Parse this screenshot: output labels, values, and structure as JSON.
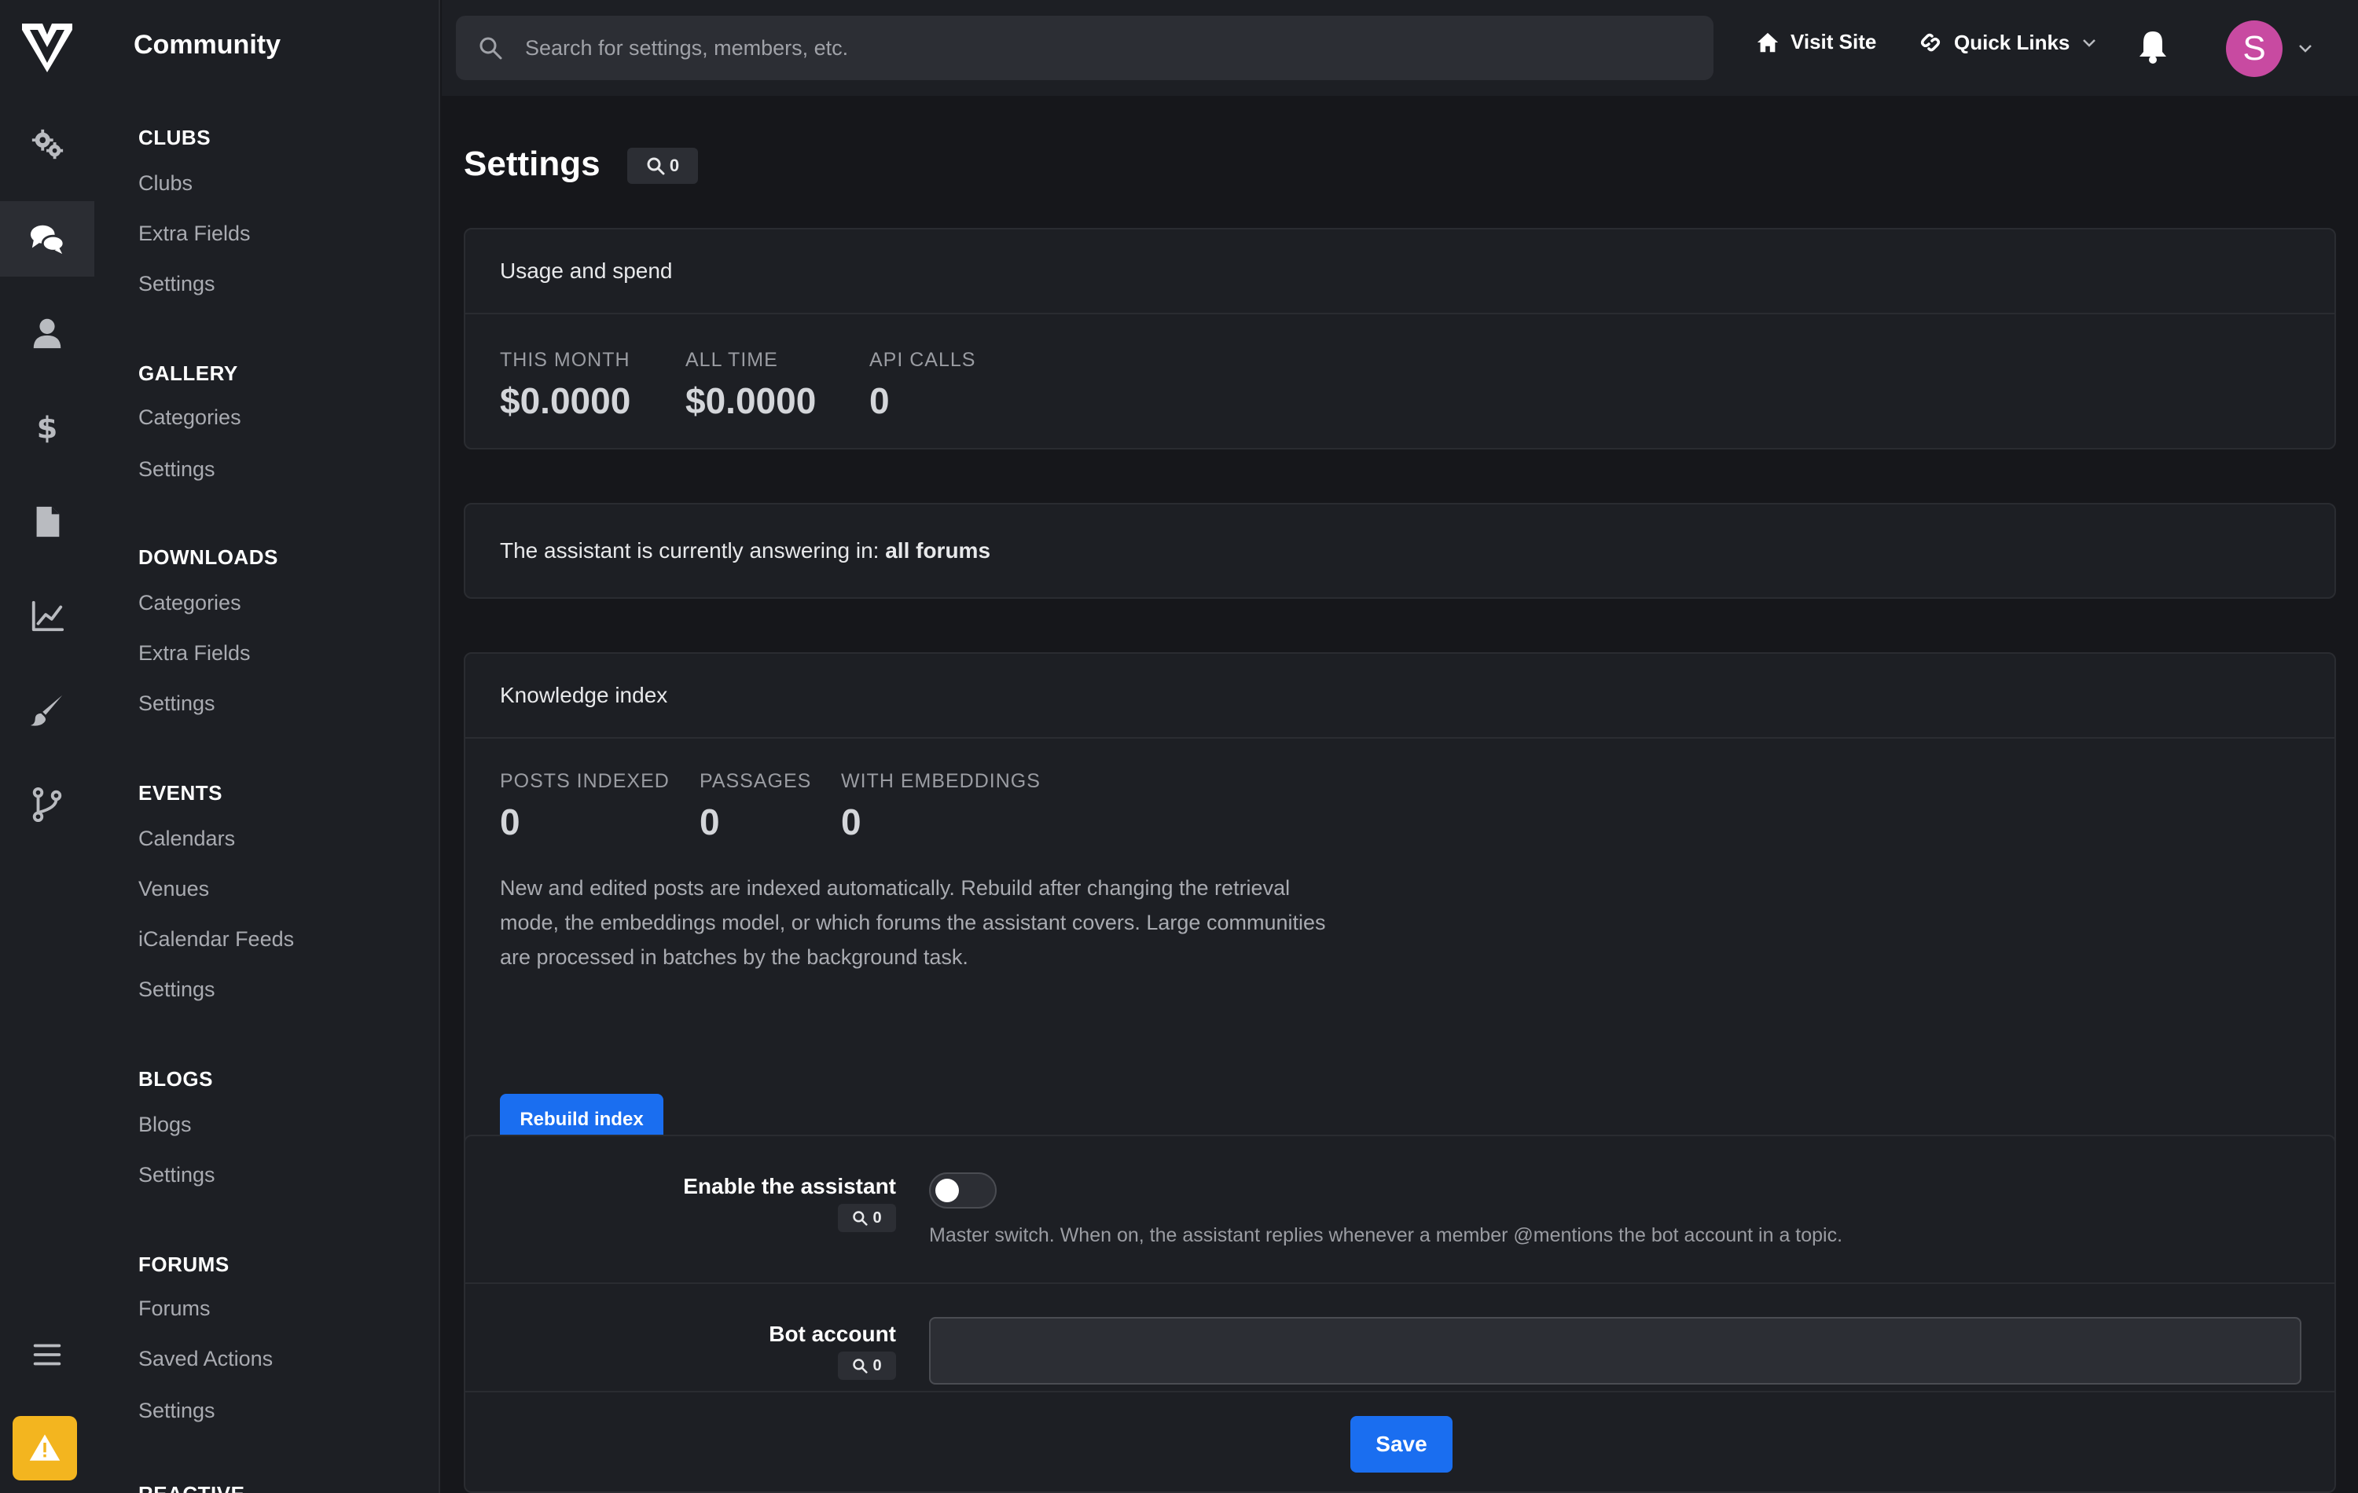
{
  "app": {
    "brand": "Community"
  },
  "rail": {
    "items": [
      {
        "icon": "gears-icon",
        "active": false
      },
      {
        "icon": "chat-bubbles-icon",
        "active": true
      },
      {
        "icon": "user-icon",
        "active": false
      },
      {
        "icon": "dollar-icon",
        "active": false
      },
      {
        "icon": "file-icon",
        "active": false
      },
      {
        "icon": "chart-line-icon",
        "active": false
      },
      {
        "icon": "brush-icon",
        "active": false
      },
      {
        "icon": "code-branch-icon",
        "active": false
      }
    ]
  },
  "sidebar": {
    "groups": [
      {
        "heading": "CLUBS",
        "items": [
          "Clubs",
          "Extra Fields",
          "Settings"
        ]
      },
      {
        "heading": "GALLERY",
        "items": [
          "Categories",
          "Settings"
        ]
      },
      {
        "heading": "DOWNLOADS",
        "items": [
          "Categories",
          "Extra Fields",
          "Settings"
        ]
      },
      {
        "heading": "EVENTS",
        "items": [
          "Calendars",
          "Venues",
          "iCalendar Feeds",
          "Settings"
        ]
      },
      {
        "heading": "BLOGS",
        "items": [
          "Blogs",
          "Settings"
        ]
      },
      {
        "heading": "FORUMS",
        "items": [
          "Forums",
          "Saved Actions",
          "Settings"
        ]
      },
      {
        "heading": "REACTIVE",
        "items": []
      }
    ]
  },
  "topbar": {
    "search_placeholder": "Search for settings, members, etc.",
    "visit_site": "Visit Site",
    "quick_links": "Quick Links",
    "avatar_letter": "S"
  },
  "page": {
    "title": "Settings",
    "search_hits": "0"
  },
  "usage": {
    "heading": "Usage and spend",
    "stats": [
      {
        "label": "THIS MONTH",
        "value": "$0.0000"
      },
      {
        "label": "ALL TIME",
        "value": "$0.0000"
      },
      {
        "label": "API CALLS",
        "value": "0"
      }
    ]
  },
  "scope": {
    "prefix": "The assistant is currently answering in:",
    "value": "all forums"
  },
  "knowledge": {
    "heading": "Knowledge index",
    "stats": [
      {
        "label": "POSTS INDEXED",
        "value": "0"
      },
      {
        "label": "PASSAGES",
        "value": "0"
      },
      {
        "label": "WITH EMBEDDINGS",
        "value": "0"
      }
    ],
    "description": "New and edited posts are indexed automatically. Rebuild after changing the retrieval mode, the embeddings model, or which forums the assistant covers. Large communities are processed in batches by the background task.",
    "rebuild_label": "Rebuild index"
  },
  "form": {
    "enable": {
      "label": "Enable the assistant",
      "hits": "0",
      "enabled": false,
      "help": "Master switch. When on, the assistant replies whenever a member @mentions the bot account in a topic."
    },
    "bot": {
      "label": "Bot account",
      "hits": "0",
      "value": ""
    },
    "save_label": "Save"
  },
  "colors": {
    "accent": "#1a6ef0",
    "avatar": "#c84aa1",
    "warning": "#f3b51f"
  }
}
